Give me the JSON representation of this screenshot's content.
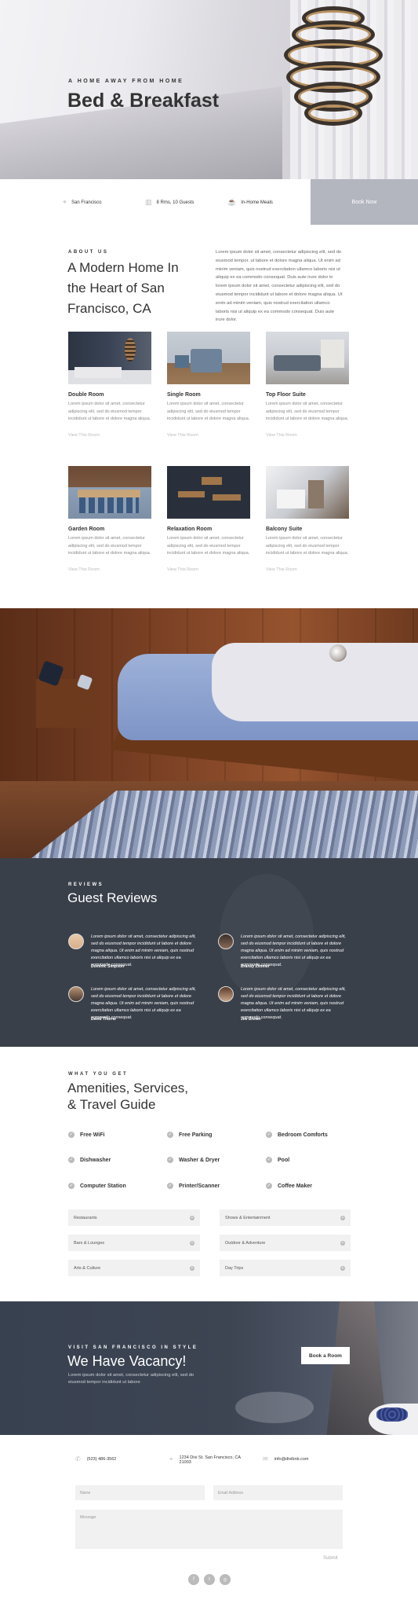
{
  "hero": {
    "eyebrow": "A HOME AWAY FROM HOME",
    "title": "Bed & Breakfast"
  },
  "info_bar": {
    "items": [
      {
        "icon": "map-pin-icon",
        "label": "San Francisco"
      },
      {
        "icon": "building-icon",
        "label": "8 Rms, 10 Guests"
      },
      {
        "icon": "coffee-icon",
        "label": "In-Home Meals"
      }
    ],
    "book_now": "Book Now"
  },
  "about": {
    "eyebrow": "ABOUT US",
    "title": "A Modern Home In the Heart of San Francisco, CA",
    "body": "Lorem ipsum dolor sit amet, consectetur adipiscing elit, sed do eiusmod tempor. ut labore et dolore magna aliqua. Ut enim ad minim veniam, quis nostrud exercitation ullamco laboris nisi ut aliquip ex ea commodo consequat. Duis aute irure dolor in lorem ipsum dolor sit amet, consectetur adipiscing elit, sed do eiusmod tempor incididunt ut labore et dolore magna aliqua. Ut enim ad minim veniam, quis nostrud exercitation ullamco laboris nisi ut aliquip ex ea commodo consequat. Duis aute irure dolor."
  },
  "rooms": [
    {
      "title": "Double Room",
      "desc": "Lorem ipsum dolor sit amet, consectetur adipiscing elit, sed do eiusmod tempor incididunt ut labore et dolore magna aliqua.",
      "link": "View This Room"
    },
    {
      "title": "Single Room",
      "desc": "Lorem ipsum dolor sit amet, consectetur adipiscing elit, sed do eiusmod tempor incididunt ut labore et dolore magna aliqua.",
      "link": "View This Room"
    },
    {
      "title": "Top Floor Suite",
      "desc": "Lorem ipsum dolor sit amet, consectetur adipiscing elit, sed do eiusmod tempor incididunt ut labore et dolore magna aliqua.",
      "link": "View This Room"
    },
    {
      "title": "Garden Room",
      "desc": "Lorem ipsum dolor sit amet, consectetur adipiscing elit, sed do eiusmod tempor incididunt ut labore et dolore magna aliqua.",
      "link": "View This Room"
    },
    {
      "title": "Relaxation Room",
      "desc": "Lorem ipsum dolor sit amet, consectetur adipiscing elit, sed do eiusmod tempor incididunt ut labore et dolore magna aliqua.",
      "link": "View This Room"
    },
    {
      "title": "Balcony Suite",
      "desc": "Lorem ipsum dolor sit amet, consectetur adipiscing elit, sed do eiusmod tempor incididunt ut labore et dolore magna aliqua.",
      "link": "View This Room"
    }
  ],
  "reviews": {
    "eyebrow": "REVIEWS",
    "title": "Guest Reviews",
    "items": [
      {
        "text": "Lorem ipsum dolor sit amet, consectetur adipiscing elit, sed do eiusmod tempor incididunt ut labore et dolore magna aliqua. Ut enim ad minim veniam, quis nostrud exercitation ullamco laboris nisi ut aliquip ex ea commodo consequat.",
        "name": "Dominic Simpson"
      },
      {
        "text": "Lorem ipsum dolor sit amet, consectetur adipiscing elit, sed do eiusmod tempor incididunt ut labore et dolore magna aliqua. Ut enim ad minim veniam, quis nostrud exercitation ullamco laboris nisi ut aliquip ex ea commodo consequat.",
        "name": "Brandy Zimmer"
      },
      {
        "text": "Lorem ipsum dolor sit amet, consectetur adipiscing elit, sed do eiusmod tempor incididunt ut labore et dolore magna aliqua. Ut enim ad minim veniam, quis nostrud exercitation ullamco laboris nisi ut aliquip ex ea commodo consequat.",
        "name": "David Thorne"
      },
      {
        "text": "Lorem ipsum dolor sit amet, consectetur adipiscing elit, sed do eiusmod tempor incididunt ut labore et dolore magna aliqua. Ut enim ad minim veniam, quis nostrud exercitation ullamco laboris nisi ut aliquip ex ea commodo consequat.",
        "name": "Joe Brown"
      }
    ]
  },
  "amenities": {
    "eyebrow": "WHAT YOU GET",
    "title_line1": "Amenities, Services,",
    "title_line2": "& Travel Guide",
    "items": [
      "Free WiFi",
      "Free Parking",
      "Bedroom Comforts",
      "Dishwasher",
      "Washer & Dryer",
      "Pool",
      "Computer Station",
      "Printer/Scanner",
      "Coffee Maker"
    ],
    "guides": [
      "Restaurants",
      "Shows & Entertainment",
      "Bars & Lounges",
      "Outdoor & Adventure",
      "Arts & Culture",
      "Day Trips"
    ]
  },
  "vacancy": {
    "eyebrow": "VISIT SAN FRANCISCO IN STYLE",
    "title": "We Have Vacancy!",
    "body": "Lorem ipsum dolor sit amet, consectetur adipiscing elit, sed do eiusmod tempor incididunt ut labore",
    "button": "Book a Room"
  },
  "contact": {
    "phone": "(523) 486-3562",
    "address_line1": "1234 Divi St. San Francisco, CA",
    "address_line2": "21003",
    "email": "info@divibnb.com",
    "name_placeholder": "Name",
    "email_placeholder": "Email Address",
    "message_placeholder": "Message",
    "submit": "Submit",
    "social": [
      {
        "icon": "facebook-icon",
        "glyph": "f"
      },
      {
        "icon": "twitter-icon",
        "glyph": "t"
      },
      {
        "icon": "instagram-icon",
        "glyph": "◎"
      }
    ]
  }
}
